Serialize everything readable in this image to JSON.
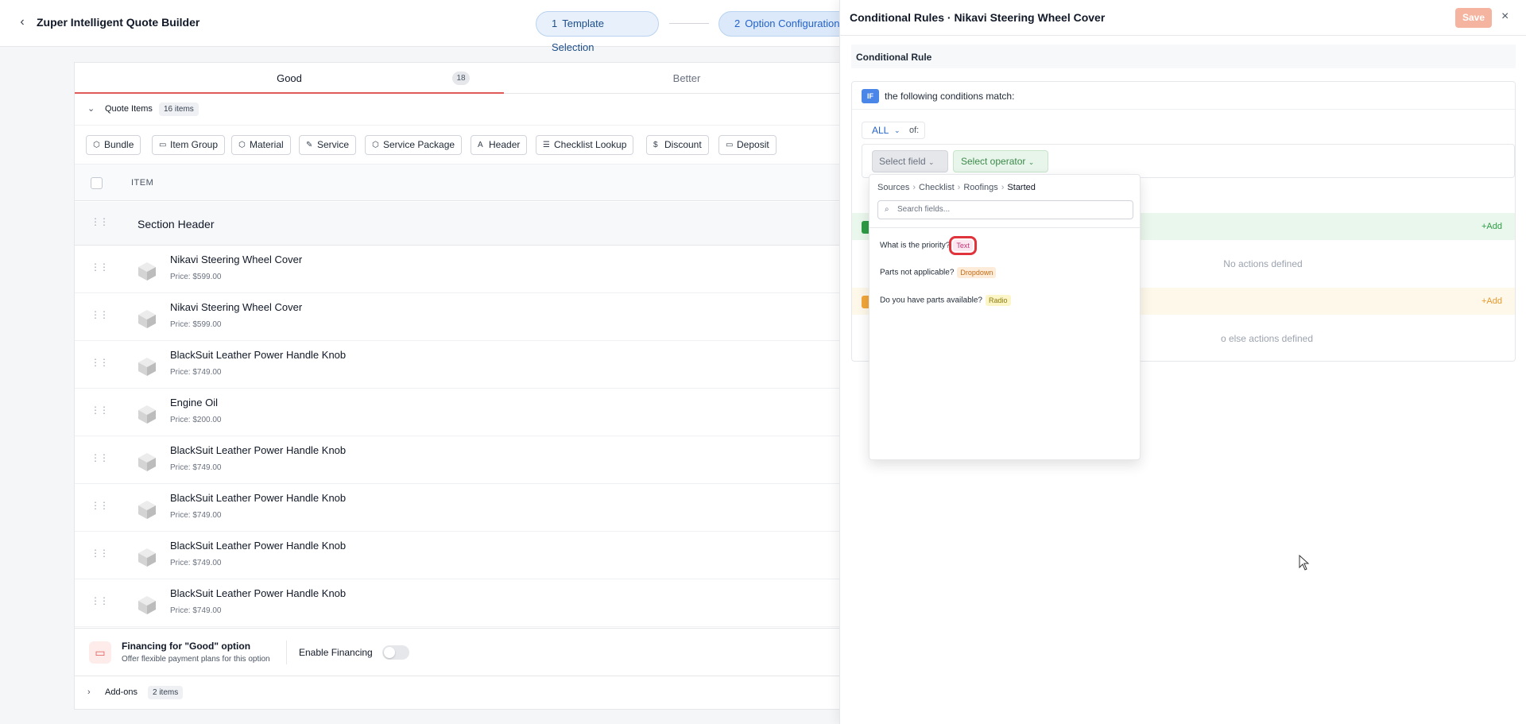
{
  "header": {
    "title": "Zuper Intelligent Quote Builder",
    "steps": [
      {
        "num": "1",
        "label": "Template Selection"
      },
      {
        "num": "2",
        "label": "Option Configuration"
      }
    ]
  },
  "tabs": [
    {
      "label": "Good",
      "badge": "18"
    },
    {
      "label": "Better"
    }
  ],
  "quote_items": {
    "label": "Quote Items",
    "badge": "16 items"
  },
  "type_buttons": [
    "Bundle",
    "Item Group",
    "Material",
    "Service",
    "Service Package",
    "Header",
    "Checklist Lookup",
    "Discount",
    "Deposit"
  ],
  "table": {
    "column_item": "ITEM"
  },
  "section_header": "Section Header",
  "items": [
    {
      "name": "Nikavi Steering Wheel Cover",
      "price": "Price: $599.00"
    },
    {
      "name": "Nikavi Steering Wheel Cover",
      "price": "Price: $599.00"
    },
    {
      "name": "BlackSuit Leather Power Handle Knob",
      "price": "Price: $749.00"
    },
    {
      "name": "Engine Oil",
      "price": "Price: $200.00"
    },
    {
      "name": "BlackSuit Leather Power Handle Knob",
      "price": "Price: $749.00"
    },
    {
      "name": "BlackSuit Leather Power Handle Knob",
      "price": "Price: $749.00"
    },
    {
      "name": "BlackSuit Leather Power Handle Knob",
      "price": "Price: $749.00"
    },
    {
      "name": "BlackSuit Leather Power Handle Knob",
      "price": "Price: $749.00"
    }
  ],
  "financing": {
    "title": "Financing for \"Good\" option",
    "subtitle": "Offer flexible payment plans for this option",
    "enable_label": "Enable Financing",
    "enabled": false
  },
  "addons": {
    "label": "Add-ons",
    "badge": "2 items"
  },
  "drawer": {
    "title": "Conditional Rules · Nikavi Steering Wheel Cover",
    "save_label": "Save",
    "section_title": "Conditional Rule",
    "if_tag": "IF",
    "if_text": "the following conditions match:",
    "match_mode": "ALL",
    "of_label": "of:",
    "select_field": "Select field",
    "select_operator": "Select operator",
    "add_then": "+Add",
    "no_actions": "No actions defined",
    "add_else": "+Add",
    "no_else": "o else actions defined"
  },
  "dropdown": {
    "breadcrumb": [
      "Sources",
      "Checklist",
      "Roofings",
      "Started"
    ],
    "search_placeholder": "Search fields...",
    "options": [
      {
        "label": "What is the priority?",
        "type": "Text"
      },
      {
        "label": "Parts not applicable?",
        "type": "Dropdown"
      },
      {
        "label": "Do you have parts available?",
        "type": "Radio"
      }
    ]
  },
  "colors": {
    "accent": "#2563c9",
    "tab_underline": "#e05a5a",
    "save_button": "#f5b49f",
    "then_green": "#2e9b45",
    "else_orange": "#f2a53a"
  }
}
